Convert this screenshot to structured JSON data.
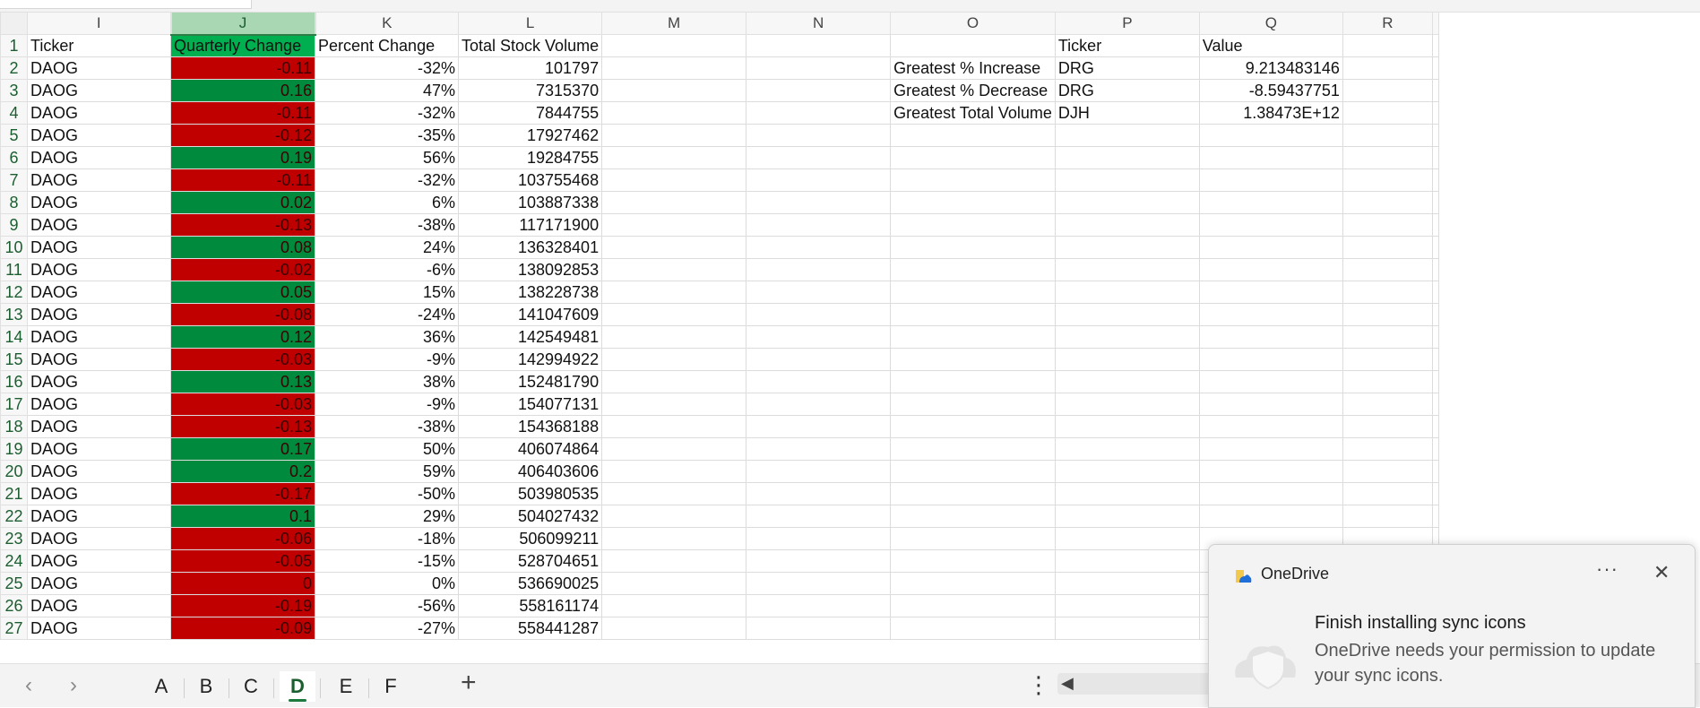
{
  "sheet": {
    "columns": [
      "I",
      "J",
      "K",
      "L",
      "M",
      "N",
      "O",
      "P",
      "Q",
      "R"
    ],
    "selected_column": "J",
    "row_numbers": [
      "1",
      "2",
      "3",
      "4",
      "5",
      "6",
      "7",
      "8",
      "9",
      "10",
      "11",
      "12",
      "13",
      "14",
      "15",
      "16",
      "17",
      "18",
      "19",
      "20",
      "21",
      "22",
      "23",
      "24",
      "25",
      "26",
      "27"
    ],
    "headers": {
      "I": "Ticker",
      "J": "Quarterly Change",
      "K": "Percent Change",
      "L": "Total Stock Volume",
      "P": "Ticker",
      "Q": "Value"
    },
    "rows": [
      {
        "ticker": "DAOG",
        "change": "-0.11",
        "pct": "-32%",
        "volume": "101797",
        "sign": "neg"
      },
      {
        "ticker": "DAOG",
        "change": "0.16",
        "pct": "47%",
        "volume": "7315370",
        "sign": "pos"
      },
      {
        "ticker": "DAOG",
        "change": "-0.11",
        "pct": "-32%",
        "volume": "7844755",
        "sign": "neg"
      },
      {
        "ticker": "DAOG",
        "change": "-0.12",
        "pct": "-35%",
        "volume": "17927462",
        "sign": "neg"
      },
      {
        "ticker": "DAOG",
        "change": "0.19",
        "pct": "56%",
        "volume": "19284755",
        "sign": "pos"
      },
      {
        "ticker": "DAOG",
        "change": "-0.11",
        "pct": "-32%",
        "volume": "103755468",
        "sign": "neg"
      },
      {
        "ticker": "DAOG",
        "change": "0.02",
        "pct": "6%",
        "volume": "103887338",
        "sign": "pos"
      },
      {
        "ticker": "DAOG",
        "change": "-0.13",
        "pct": "-38%",
        "volume": "117171900",
        "sign": "neg"
      },
      {
        "ticker": "DAOG",
        "change": "0.08",
        "pct": "24%",
        "volume": "136328401",
        "sign": "pos"
      },
      {
        "ticker": "DAOG",
        "change": "-0.02",
        "pct": "-6%",
        "volume": "138092853",
        "sign": "neg"
      },
      {
        "ticker": "DAOG",
        "change": "0.05",
        "pct": "15%",
        "volume": "138228738",
        "sign": "pos"
      },
      {
        "ticker": "DAOG",
        "change": "-0.08",
        "pct": "-24%",
        "volume": "141047609",
        "sign": "neg"
      },
      {
        "ticker": "DAOG",
        "change": "0.12",
        "pct": "36%",
        "volume": "142549481",
        "sign": "pos"
      },
      {
        "ticker": "DAOG",
        "change": "-0.03",
        "pct": "-9%",
        "volume": "142994922",
        "sign": "neg"
      },
      {
        "ticker": "DAOG",
        "change": "0.13",
        "pct": "38%",
        "volume": "152481790",
        "sign": "pos"
      },
      {
        "ticker": "DAOG",
        "change": "-0.03",
        "pct": "-9%",
        "volume": "154077131",
        "sign": "neg"
      },
      {
        "ticker": "DAOG",
        "change": "-0.13",
        "pct": "-38%",
        "volume": "154368188",
        "sign": "neg"
      },
      {
        "ticker": "DAOG",
        "change": "0.17",
        "pct": "50%",
        "volume": "406074864",
        "sign": "pos"
      },
      {
        "ticker": "DAOG",
        "change": "0.2",
        "pct": "59%",
        "volume": "406403606",
        "sign": "pos"
      },
      {
        "ticker": "DAOG",
        "change": "-0.17",
        "pct": "-50%",
        "volume": "503980535",
        "sign": "neg"
      },
      {
        "ticker": "DAOG",
        "change": "0.1",
        "pct": "29%",
        "volume": "504027432",
        "sign": "pos"
      },
      {
        "ticker": "DAOG",
        "change": "-0.06",
        "pct": "-18%",
        "volume": "506099211",
        "sign": "neg"
      },
      {
        "ticker": "DAOG",
        "change": "-0.05",
        "pct": "-15%",
        "volume": "528704651",
        "sign": "neg"
      },
      {
        "ticker": "DAOG",
        "change": "0",
        "pct": "0%",
        "volume": "536690025",
        "sign": "neg"
      },
      {
        "ticker": "DAOG",
        "change": "-0.19",
        "pct": "-56%",
        "volume": "558161174",
        "sign": "neg"
      },
      {
        "ticker": "DAOG",
        "change": "-0.09",
        "pct": "-27%",
        "volume": "558441287",
        "sign": "neg"
      }
    ],
    "summary": [
      {
        "label": "Greatest % Increase",
        "ticker": "DRG",
        "value": "9.213483146"
      },
      {
        "label": "Greatest % Decrease",
        "ticker": "DRG",
        "value": "-8.59437751"
      },
      {
        "label": "Greatest Total Volume",
        "ticker": "DJH",
        "value": "1.38473E+12"
      }
    ],
    "colors": {
      "negative_fill": "#c00000",
      "positive_fill": "#008a3e",
      "header_fill": "#00b050",
      "selection_header": "#a9d6b3"
    }
  },
  "tabs": {
    "prev_icon": "chevron-left-icon",
    "next_icon": "chevron-right-icon",
    "sheets": [
      "A",
      "B",
      "C",
      "D",
      "E",
      "F"
    ],
    "active": "D",
    "add_label": "+",
    "more_label": "⋮"
  },
  "toast": {
    "app": "OneDrive",
    "more": "···",
    "close": "✕",
    "title": "Finish installing sync icons",
    "body": "OneDrive needs your permission to update your sync icons."
  }
}
